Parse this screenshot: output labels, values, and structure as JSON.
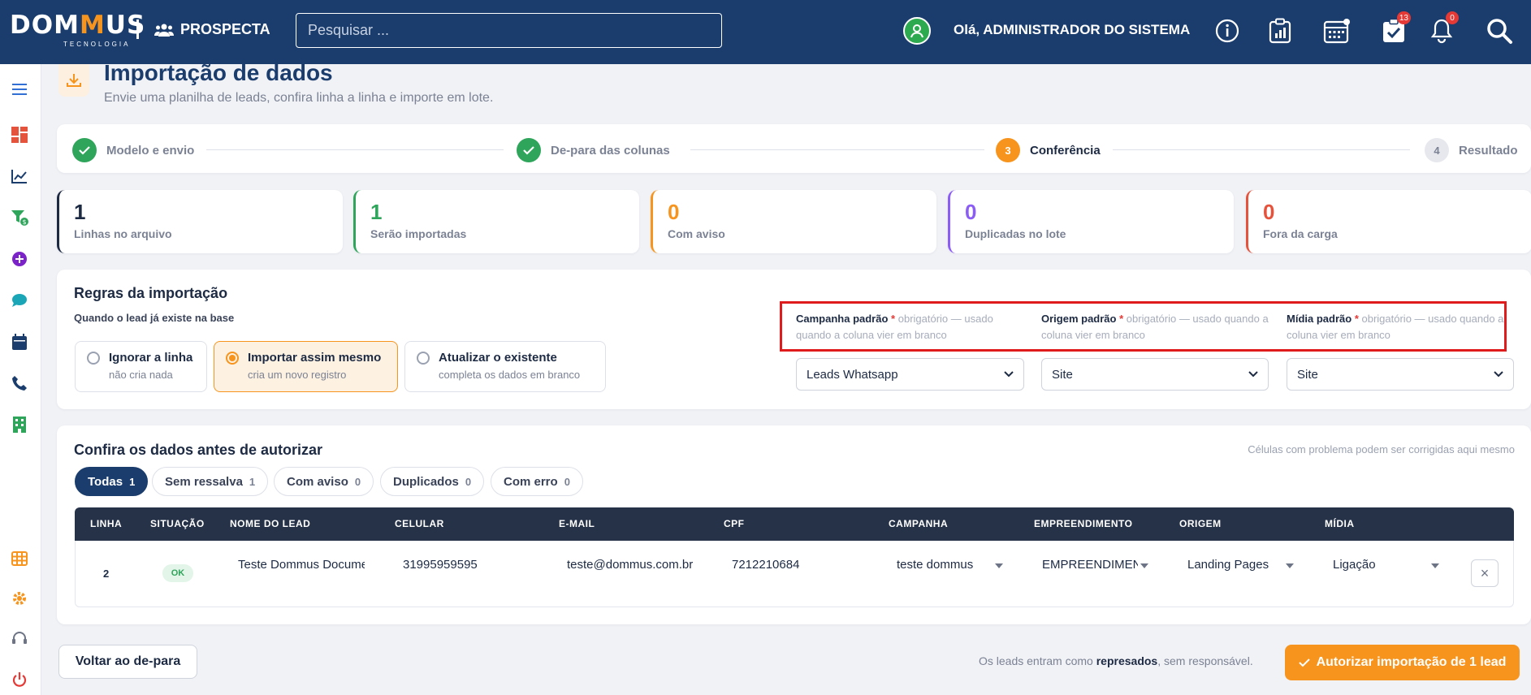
{
  "brand": {
    "logo_left": "DOM",
    "logo_m": "M",
    "logo_right": "US",
    "logo_sub": "TECNOLOGIA",
    "module": "PROSPECTA"
  },
  "search": {
    "placeholder": "Pesquisar ..."
  },
  "user": {
    "greeting": "Olá, ADMINISTRADOR DO SISTEMA"
  },
  "badges": {
    "tasks": "13",
    "notifications": "0"
  },
  "header": {
    "title": "Importação de dados",
    "subtitle": "Envie uma planilha de leads, confira linha a linha e importe em lote."
  },
  "steps": [
    {
      "label": "Modelo e envio",
      "state": "done"
    },
    {
      "label": "De-para das colunas",
      "state": "done"
    },
    {
      "num": "3",
      "label": "Conferência",
      "state": "active"
    },
    {
      "num": "4",
      "label": "Resultado",
      "state": "todo"
    }
  ],
  "stats": [
    {
      "value": "1",
      "label": "Linhas no arquivo",
      "color": "#1d2a43"
    },
    {
      "value": "1",
      "label": "Serão importadas",
      "color": "#2fa55b"
    },
    {
      "value": "0",
      "label": "Com aviso",
      "color": "#f7941d"
    },
    {
      "value": "0",
      "label": "Duplicadas no lote",
      "color": "#8b5cf6"
    },
    {
      "value": "0",
      "label": "Fora da carga",
      "color": "#e5533d"
    }
  ],
  "rules": {
    "title": "Regras da importação",
    "question": "Quando o lead já existe na base",
    "options": [
      {
        "title": "Ignorar a linha",
        "sub": "não cria nada"
      },
      {
        "title": "Importar assim mesmo",
        "sub": "cria um novo registro"
      },
      {
        "title": "Atualizar o existente",
        "sub": "completa os dados em branco"
      }
    ],
    "selected_option": "Importar assim mesmo",
    "defaults": [
      {
        "label": "Campanha padrão",
        "note": "obrigatório — usado quando a coluna vier em branco",
        "value": "Leads Whatsapp"
      },
      {
        "label": "Origem padrão",
        "note": "obrigatório — usado quando a coluna vier em branco",
        "value": "Site"
      },
      {
        "label": "Mídia padrão",
        "note": "obrigatório — usado quando a coluna vier em branco",
        "value": "Site"
      }
    ],
    "required_mark": "*"
  },
  "review": {
    "title": "Confira os dados antes de autorizar",
    "hint": "Células com problema podem ser corrigidas aqui mesmo",
    "filters": [
      {
        "label": "Todas",
        "count": "1"
      },
      {
        "label": "Sem ressalva",
        "count": "1"
      },
      {
        "label": "Com aviso",
        "count": "0"
      },
      {
        "label": "Duplicados",
        "count": "0"
      },
      {
        "label": "Com erro",
        "count": "0"
      }
    ],
    "active_filter": "Todas",
    "columns": [
      "LINHA",
      "SITUAÇÃO",
      "NOME DO LEAD",
      "CELULAR",
      "E-MAIL",
      "CPF",
      "CAMPANHA",
      "EMPREENDIMENTO",
      "ORIGEM",
      "MÍDIA"
    ],
    "rows": [
      {
        "linha": "2",
        "situacao": "OK",
        "nome": "Teste Dommus Documentos",
        "celular": "31995959595",
        "email": "teste@dommus.com.br",
        "cpf": "7212210684",
        "campanha": "teste dommus",
        "empreendimento": "EMPREENDIMENTO",
        "origem": "Landing Pages",
        "midia": "Ligação"
      }
    ]
  },
  "footer": {
    "back": "Voltar ao de-para",
    "note_pre": "Os leads entram como ",
    "note_bold": "represados",
    "note_post": ", sem responsável.",
    "authorize": "Autorizar importação de 1 lead"
  }
}
